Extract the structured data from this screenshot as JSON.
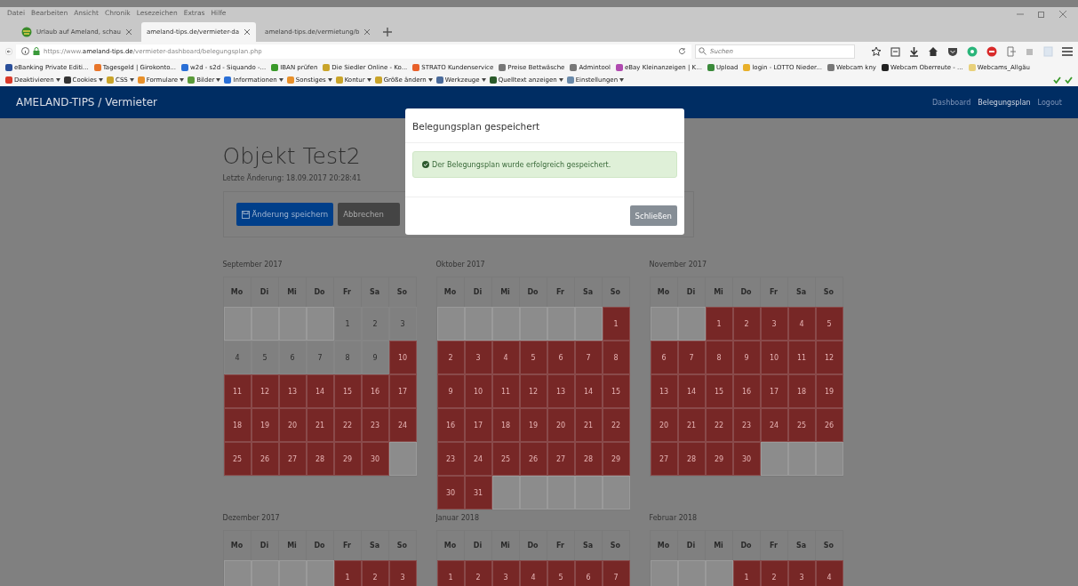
{
  "browser": {
    "menu": [
      "Datei",
      "Bearbeiten",
      "Ansicht",
      "Chronik",
      "Lesezeichen",
      "Extras",
      "Hilfe"
    ],
    "tabs": [
      {
        "label": "Urlaub auf Ameland, schau",
        "selected": false
      },
      {
        "label": "ameland-tips.de/vermieter-da",
        "selected": true
      },
      {
        "label": "ameland-tips.de/vermietung/b",
        "selected": false
      }
    ],
    "url": {
      "prefix": "https://www.",
      "domain": "ameland-tips.de",
      "path": "/vermieter-dashboard/belegungsplan.php"
    },
    "search": {
      "placeholder": "Suchen"
    },
    "bookmarks": [
      {
        "label": "eBanking Private Editi...",
        "color": "#2a4f9a"
      },
      {
        "label": "Tagesgeld | Girokonto...",
        "color": "#e8752a"
      },
      {
        "label": "w2d - s2d - Siquando -...",
        "color": "#2a6fd6"
      },
      {
        "label": "IBAN prüfen",
        "color": "#3a9a2a"
      },
      {
        "label": "Die Siedler Online - Ko...",
        "color": "#c9a42a"
      },
      {
        "label": "STRATO Kundenservice",
        "color": "#e8602a"
      },
      {
        "label": "Preise Bettwäsche",
        "color": "#777777"
      },
      {
        "label": "Admintool",
        "color": "#777777"
      },
      {
        "label": "eBay Kleinanzeigen | K...",
        "color": "#b04ab0"
      },
      {
        "label": "Upload",
        "color": "#3a8a3a"
      },
      {
        "label": "login - LOTTO Nieder...",
        "color": "#e8b02a"
      },
      {
        "label": "Webcam kny",
        "color": "#777777"
      },
      {
        "label": "Webcam Oberreute - ...",
        "color": "#222222"
      },
      {
        "label": "Webcams_Allgäu",
        "color": "#e8d07a"
      }
    ],
    "devtools": [
      {
        "label": "Deaktivieren",
        "color": "#d93a2a"
      },
      {
        "label": "Cookies",
        "color": "#333333"
      },
      {
        "label": "CSS",
        "color": "#c9a42a"
      },
      {
        "label": "Formulare",
        "color": "#e8902a"
      },
      {
        "label": "Bilder",
        "color": "#5a9a3a"
      },
      {
        "label": "Informationen",
        "color": "#2a6fd6"
      },
      {
        "label": "Sonstiges",
        "color": "#e8902a"
      },
      {
        "label": "Kontur",
        "color": "#c9a42a"
      },
      {
        "label": "Größe ändern",
        "color": "#c9a42a"
      },
      {
        "label": "Werkzeuge",
        "color": "#4a6a9a"
      },
      {
        "label": "Quelltext anzeigen",
        "color": "#2a5a2a"
      },
      {
        "label": "Einstellungen",
        "color": "#6a8aaa"
      }
    ]
  },
  "navbar": {
    "brand": "AMELAND-TIPS / Vermieter",
    "links": [
      {
        "label": "Dashboard",
        "selected": false
      },
      {
        "label": "Belegungsplan",
        "selected": true
      },
      {
        "label": "Logout",
        "selected": false
      }
    ]
  },
  "page": {
    "title": "Objekt Test2",
    "last_change": "Letzte Änderung: 18.09.2017 20:28:41",
    "buttons": [
      {
        "label": "Änderung speichern",
        "kind": "primary"
      },
      {
        "label": "Abbrechen",
        "kind": "secondary"
      }
    ]
  },
  "calendar": {
    "months": [
      {
        "title": "September 2017",
        "weekdays": [
          "Mo",
          "Di",
          "Mi",
          "Do",
          "Fr",
          "Sa",
          "So"
        ],
        "weeks": [
          [
            {
              "kind": "empty"
            },
            {
              "kind": "empty"
            },
            {
              "kind": "empty"
            },
            {
              "kind": "empty"
            },
            {
              "day": "1",
              "booked": false
            },
            {
              "day": "2",
              "booked": false
            },
            {
              "day": "3",
              "booked": false
            }
          ],
          [
            {
              "day": "4",
              "booked": false
            },
            {
              "day": "5",
              "booked": false
            },
            {
              "day": "6",
              "booked": false
            },
            {
              "day": "7",
              "booked": false
            },
            {
              "day": "8",
              "booked": false
            },
            {
              "day": "9",
              "booked": false
            },
            {
              "day": "10",
              "booked": true
            }
          ],
          [
            {
              "day": "11",
              "booked": true
            },
            {
              "day": "12",
              "booked": true
            },
            {
              "day": "13",
              "booked": true
            },
            {
              "day": "14",
              "booked": true
            },
            {
              "day": "15",
              "booked": true
            },
            {
              "day": "16",
              "booked": true
            },
            {
              "day": "17",
              "booked": true
            }
          ],
          [
            {
              "day": "18",
              "booked": true
            },
            {
              "day": "19",
              "booked": true
            },
            {
              "day": "20",
              "booked": true
            },
            {
              "day": "21",
              "booked": true
            },
            {
              "day": "22",
              "booked": true
            },
            {
              "day": "23",
              "booked": true
            },
            {
              "day": "24",
              "booked": true
            }
          ],
          [
            {
              "day": "25",
              "booked": true
            },
            {
              "day": "26",
              "booked": true
            },
            {
              "day": "27",
              "booked": true
            },
            {
              "day": "28",
              "booked": true
            },
            {
              "day": "29",
              "booked": true
            },
            {
              "day": "30",
              "booked": true
            },
            {
              "kind": "empty"
            }
          ]
        ]
      },
      {
        "title": "Oktober 2017",
        "weekdays": [
          "Mo",
          "Di",
          "Mi",
          "Do",
          "Fr",
          "Sa",
          "So"
        ],
        "weeks": [
          [
            {
              "kind": "empty"
            },
            {
              "kind": "empty"
            },
            {
              "kind": "empty"
            },
            {
              "kind": "empty"
            },
            {
              "kind": "empty"
            },
            {
              "kind": "empty"
            },
            {
              "day": "1",
              "booked": true
            }
          ],
          [
            {
              "day": "2",
              "booked": true
            },
            {
              "day": "3",
              "booked": true
            },
            {
              "day": "4",
              "booked": true
            },
            {
              "day": "5",
              "booked": true
            },
            {
              "day": "6",
              "booked": true
            },
            {
              "day": "7",
              "booked": true
            },
            {
              "day": "8",
              "booked": true
            }
          ],
          [
            {
              "day": "9",
              "booked": true
            },
            {
              "day": "10",
              "booked": true
            },
            {
              "day": "11",
              "booked": true
            },
            {
              "day": "12",
              "booked": true
            },
            {
              "day": "13",
              "booked": true
            },
            {
              "day": "14",
              "booked": true
            },
            {
              "day": "15",
              "booked": true
            }
          ],
          [
            {
              "day": "16",
              "booked": true
            },
            {
              "day": "17",
              "booked": true
            },
            {
              "day": "18",
              "booked": true
            },
            {
              "day": "19",
              "booked": true
            },
            {
              "day": "20",
              "booked": true
            },
            {
              "day": "21",
              "booked": true
            },
            {
              "day": "22",
              "booked": true
            }
          ],
          [
            {
              "day": "23",
              "booked": true
            },
            {
              "day": "24",
              "booked": true
            },
            {
              "day": "25",
              "booked": true
            },
            {
              "day": "26",
              "booked": true
            },
            {
              "day": "27",
              "booked": true
            },
            {
              "day": "28",
              "booked": true
            },
            {
              "day": "29",
              "booked": true
            }
          ],
          [
            {
              "day": "30",
              "booked": true
            },
            {
              "day": "31",
              "booked": true
            },
            {
              "kind": "empty"
            },
            {
              "kind": "empty"
            },
            {
              "kind": "empty"
            },
            {
              "kind": "empty"
            },
            {
              "kind": "empty"
            }
          ]
        ]
      },
      {
        "title": "November 2017",
        "weekdays": [
          "Mo",
          "Di",
          "Mi",
          "Do",
          "Fr",
          "Sa",
          "So"
        ],
        "weeks": [
          [
            {
              "kind": "empty"
            },
            {
              "kind": "empty"
            },
            {
              "day": "1",
              "booked": true
            },
            {
              "day": "2",
              "booked": true
            },
            {
              "day": "3",
              "booked": true
            },
            {
              "day": "4",
              "booked": true
            },
            {
              "day": "5",
              "booked": true
            }
          ],
          [
            {
              "day": "6",
              "booked": true
            },
            {
              "day": "7",
              "booked": true
            },
            {
              "day": "8",
              "booked": true
            },
            {
              "day": "9",
              "booked": true
            },
            {
              "day": "10",
              "booked": true
            },
            {
              "day": "11",
              "booked": true
            },
            {
              "day": "12",
              "booked": true
            }
          ],
          [
            {
              "day": "13",
              "booked": true
            },
            {
              "day": "14",
              "booked": true
            },
            {
              "day": "15",
              "booked": true
            },
            {
              "day": "16",
              "booked": true
            },
            {
              "day": "17",
              "booked": true
            },
            {
              "day": "18",
              "booked": true
            },
            {
              "day": "19",
              "booked": true
            }
          ],
          [
            {
              "day": "20",
              "booked": true
            },
            {
              "day": "21",
              "booked": true
            },
            {
              "day": "22",
              "booked": true
            },
            {
              "day": "23",
              "booked": true
            },
            {
              "day": "24",
              "booked": true
            },
            {
              "day": "25",
              "booked": true
            },
            {
              "day": "26",
              "booked": true
            }
          ],
          [
            {
              "day": "27",
              "booked": true
            },
            {
              "day": "28",
              "booked": true
            },
            {
              "day": "29",
              "booked": true
            },
            {
              "day": "30",
              "booked": true
            },
            {
              "kind": "empty"
            },
            {
              "kind": "empty"
            },
            {
              "kind": "empty"
            }
          ]
        ]
      },
      {
        "title": "Dezember 2017",
        "weekdays": [
          "Mo",
          "Di",
          "Mi",
          "Do",
          "Fr",
          "Sa",
          "So"
        ],
        "weeks": [
          [
            {
              "kind": "empty"
            },
            {
              "kind": "empty"
            },
            {
              "kind": "empty"
            },
            {
              "kind": "empty"
            },
            {
              "day": "1",
              "booked": true
            },
            {
              "day": "2",
              "booked": true
            },
            {
              "day": "3",
              "booked": true
            }
          ]
        ]
      },
      {
        "title": "Januar 2018",
        "weekdays": [
          "Mo",
          "Di",
          "Mi",
          "Do",
          "Fr",
          "Sa",
          "So"
        ],
        "weeks": [
          [
            {
              "day": "1",
              "booked": true
            },
            {
              "day": "2",
              "booked": true
            },
            {
              "day": "3",
              "booked": true
            },
            {
              "day": "4",
              "booked": true
            },
            {
              "day": "5",
              "booked": true
            },
            {
              "day": "6",
              "booked": true
            },
            {
              "day": "7",
              "booked": true
            }
          ]
        ]
      },
      {
        "title": "Februar 2018",
        "weekdays": [
          "Mo",
          "Di",
          "Mi",
          "Do",
          "Fr",
          "Sa",
          "So"
        ],
        "weeks": [
          [
            {
              "kind": "empty"
            },
            {
              "kind": "empty"
            },
            {
              "kind": "empty"
            },
            {
              "day": "1",
              "booked": true
            },
            {
              "day": "2",
              "booked": true
            },
            {
              "day": "3",
              "booked": true
            },
            {
              "day": "4",
              "booked": true
            }
          ]
        ]
      }
    ]
  },
  "modal": {
    "title": "Belegungsplan gespeichert",
    "message": "Der Belegungsplan wurde erfolgreich gespeichert.",
    "button": "Schließen"
  }
}
